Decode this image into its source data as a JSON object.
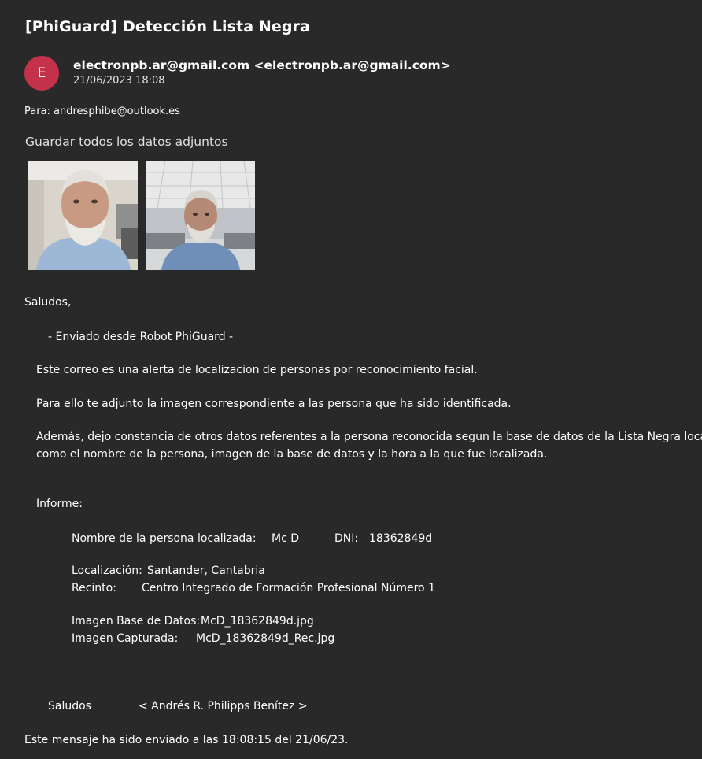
{
  "email": {
    "subject": "[PhiGuard] Detección Lista Negra",
    "avatar_initial": "E",
    "sender": "electronpb.ar@gmail.com <electronpb.ar@gmail.com>",
    "date": "21/06/2023 18:08",
    "to": "Para: andresphibe@outlook.es",
    "save_attachments_label": "Guardar todos los datos adjuntos",
    "avatar_color": "#c4314b"
  },
  "attachments": [
    {
      "icon": "photo-thumbnail"
    },
    {
      "icon": "photo-thumbnail"
    }
  ],
  "message": {
    "greeting": "Saludos,",
    "sent_from": "- Enviado desde Robot PhiGuard -",
    "p1": "Este correo es una alerta de localizacion de personas por reconocimiento facial.",
    "p2": "Para ello te adjunto la imagen correspondiente a las persona que ha sido identificada.",
    "p3_line1": "Además, dejo constancia de otros datos referentes a la persona reconocida segun la base de datos de la Lista Negra local",
    "p3_line2": "como el nombre de la persona, imagen de la base de datos y la hora a la que fue localizada.",
    "report_label": "Informe:",
    "name_label": "Nombre de la persona localizada:",
    "name_value": "Mc D",
    "dni_label": "DNI:",
    "dni_value": "18362849d",
    "location_label": "Localización:",
    "location_value": "Santander, Cantabria",
    "venue_label": "Recinto:",
    "venue_value": "Centro Integrado de Formación Profesional Número 1",
    "db_image_label": "Imagen Base de Datos:",
    "db_image_value": "McD_18362849d.jpg",
    "captured_image_label": "Imagen Capturada:",
    "captured_image_value": "McD_18362849d_Rec.jpg",
    "closing": "Saludos",
    "signature": "< Andrés R. Philipps Benítez >",
    "footer": "Este mensaje ha sido enviado a las 18:08:15 del 21/06/23."
  }
}
